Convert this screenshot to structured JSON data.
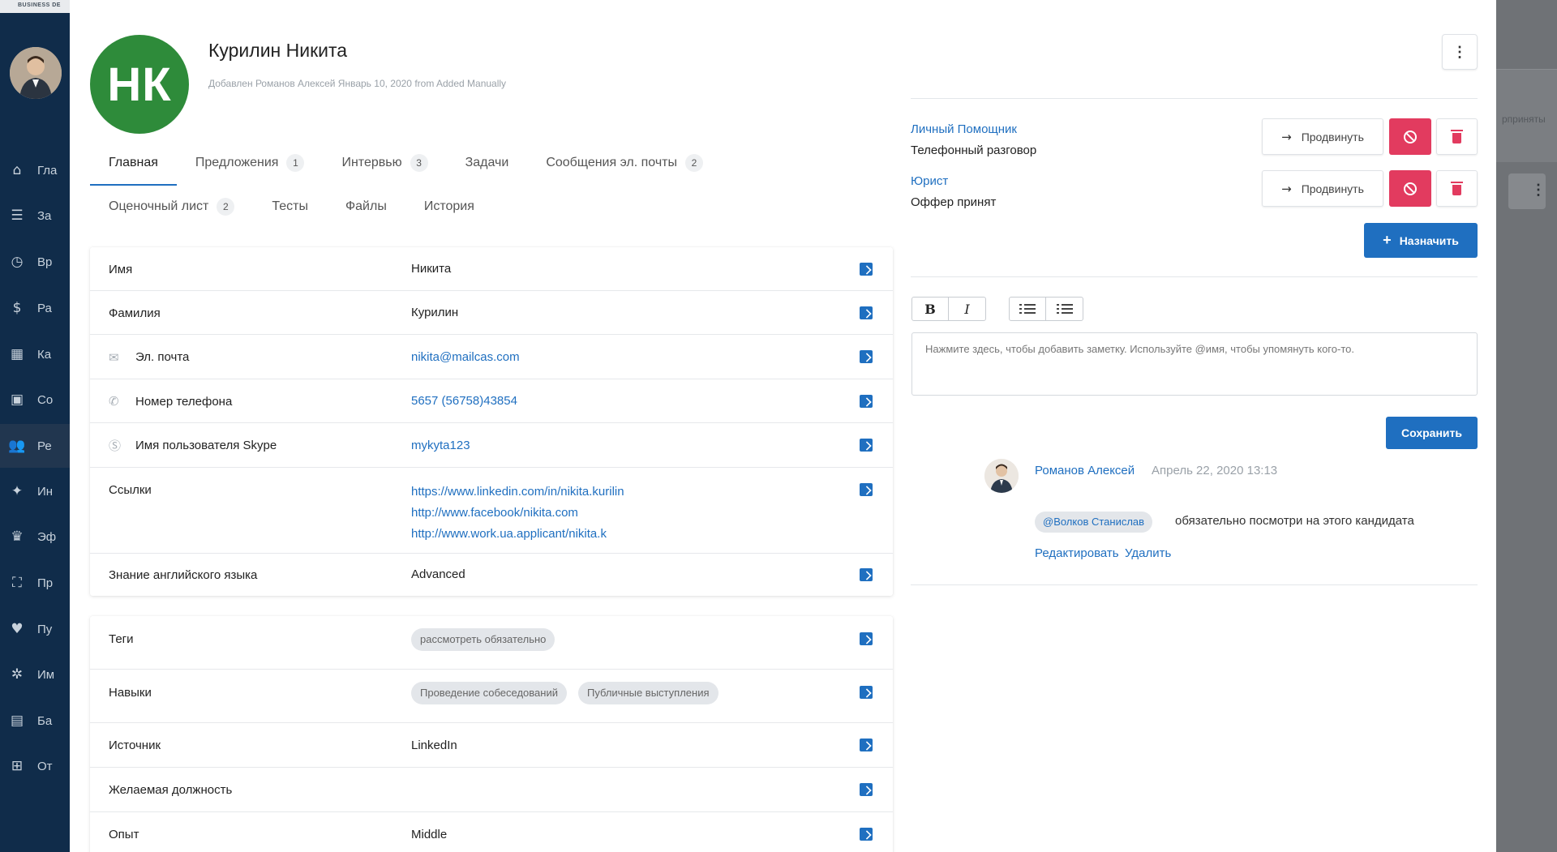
{
  "background": {
    "brand": "BUSINESS DE",
    "nav": [
      {
        "icon": "home-icon",
        "glyph": "⌂",
        "label": "Гла"
      },
      {
        "icon": "list-icon",
        "glyph": "☰",
        "label": "За"
      },
      {
        "icon": "clock-icon",
        "glyph": "◷",
        "label": "Вр"
      },
      {
        "icon": "dollar-icon",
        "glyph": "$",
        "label": "Ра"
      },
      {
        "icon": "calendar-icon",
        "glyph": "▦",
        "label": "Ка"
      },
      {
        "icon": "contacts-icon",
        "glyph": "▣",
        "label": "Со"
      },
      {
        "icon": "users-icon",
        "glyph": "👥",
        "label": "Ре"
      },
      {
        "icon": "handshake-icon",
        "glyph": "✦",
        "label": "Ин"
      },
      {
        "icon": "trophy-icon",
        "glyph": "♛",
        "label": "Эф"
      },
      {
        "icon": "sitemap-icon",
        "glyph": "⛶",
        "label": "Пр"
      },
      {
        "icon": "heart-icon",
        "glyph": "♥",
        "label": "Пу"
      },
      {
        "icon": "network-icon",
        "glyph": "✲",
        "label": "Им"
      },
      {
        "icon": "book-icon",
        "glyph": "▤",
        "label": "Ба"
      },
      {
        "icon": "table-icon",
        "glyph": "⊞",
        "label": "От"
      }
    ],
    "right_text": "рприняты"
  },
  "candidate": {
    "initials": "НК",
    "name": "Курилин Никита",
    "meta": "Добавлен Романов Алексей Январь 10, 2020 from Added Manually",
    "avatar_color": "#2e8b3a"
  },
  "tabs_row1": [
    {
      "label": "Главная",
      "badge": ""
    },
    {
      "label": "Предложения",
      "badge": "1"
    },
    {
      "label": "Интервью",
      "badge": "3"
    },
    {
      "label": "Задачи",
      "badge": ""
    },
    {
      "label": "Сообщения эл. почты",
      "badge": "2"
    }
  ],
  "tabs_row2": [
    {
      "label": "Оценочный лист",
      "badge": "2"
    },
    {
      "label": "Тесты",
      "badge": ""
    },
    {
      "label": "Файлы",
      "badge": ""
    },
    {
      "label": "История",
      "badge": ""
    }
  ],
  "fields": {
    "first_name": {
      "label": "Имя",
      "value": "Никита"
    },
    "last_name": {
      "label": "Фамилия",
      "value": "Курилин"
    },
    "email": {
      "label": "Эл. почта",
      "value": "nikita@mailcas.com"
    },
    "phone": {
      "label": "Номер телефона",
      "value": "5657 (56758)43854"
    },
    "skype": {
      "label": "Имя пользователя Skype",
      "value": "mykyta123"
    },
    "links": {
      "label": "Ссылки",
      "values": [
        "https://www.linkedin.com/in/nikita.kurilin",
        "http://www.facebook/nikita.com",
        "http://www.work.ua.applicant/nikita.k"
      ]
    },
    "english": {
      "label": "Знание английского языка",
      "value": "Advanced"
    }
  },
  "fields2": {
    "tags": {
      "label": "Теги",
      "values": [
        "рассмотреть обязательно"
      ]
    },
    "skills": {
      "label": "Навыки",
      "values": [
        "Проведение собеседований",
        "Публичные выступления"
      ]
    },
    "source": {
      "label": "Источник",
      "value": "LinkedIn"
    },
    "desired_position": {
      "label": "Желаемая должность",
      "value": ""
    },
    "experience": {
      "label": "Опыт",
      "value": "Middle"
    }
  },
  "pipeline": [
    {
      "title": "Личный Помощник",
      "stage": "Телефонный разговор"
    },
    {
      "title": "Юрист",
      "stage": "Оффер принят"
    }
  ],
  "buttons": {
    "advance": "Продвинуть",
    "assign": "Назначить",
    "save": "Сохранить",
    "more": "⋮"
  },
  "editor": {
    "bold": "B",
    "italic": "I",
    "placeholder": "Нажмите здесь, чтобы добавить заметку. Используйте @имя, чтобы упомянуть кого-то."
  },
  "comment": {
    "author": "Романов Алексей",
    "date": "Апрель 22, 2020 13:13",
    "mention": "@Волков Станислав",
    "text": "обязательно посмотри на этого кандидата",
    "edit": "Редактировать",
    "delete": "Удалить"
  },
  "colors": {
    "accent": "#1f6fc0",
    "danger": "#e23b5f",
    "sidebar": "#102c4a"
  }
}
